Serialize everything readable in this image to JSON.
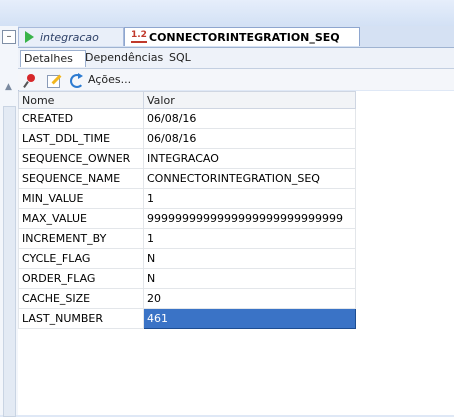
{
  "doc_tabs": [
    {
      "label": "integracao"
    },
    {
      "label": "CONNECTORINTEGRATION_SEQ"
    }
  ],
  "seq_icon_text": "1.2",
  "sub_tabs": [
    {
      "label": "Detalhes"
    },
    {
      "label": "Dependências"
    },
    {
      "label": "SQL"
    }
  ],
  "toolbar": {
    "actions_label": "Ações..."
  },
  "grid": {
    "headers": {
      "name": "Nome",
      "value": "Valor"
    },
    "rows": [
      {
        "name": "CREATED",
        "value": "06/08/16"
      },
      {
        "name": "LAST_DDL_TIME",
        "value": "06/08/16"
      },
      {
        "name": "SEQUENCE_OWNER",
        "value": "INTEGRACAO"
      },
      {
        "name": "SEQUENCE_NAME",
        "value": "CONNECTORINTEGRATION_SEQ"
      },
      {
        "name": "MIN_VALUE",
        "value": "1"
      },
      {
        "name": "MAX_VALUE",
        "value": "9999999999999999999999999999"
      },
      {
        "name": "INCREMENT_BY",
        "value": "1"
      },
      {
        "name": "CYCLE_FLAG",
        "value": "N"
      },
      {
        "name": "ORDER_FLAG",
        "value": "N"
      },
      {
        "name": "CACHE_SIZE",
        "value": "20"
      },
      {
        "name": "LAST_NUMBER",
        "value": "461",
        "selected": true
      }
    ]
  },
  "colors": {
    "selection": "#3a73c6",
    "play_icon": "#38b34a"
  }
}
